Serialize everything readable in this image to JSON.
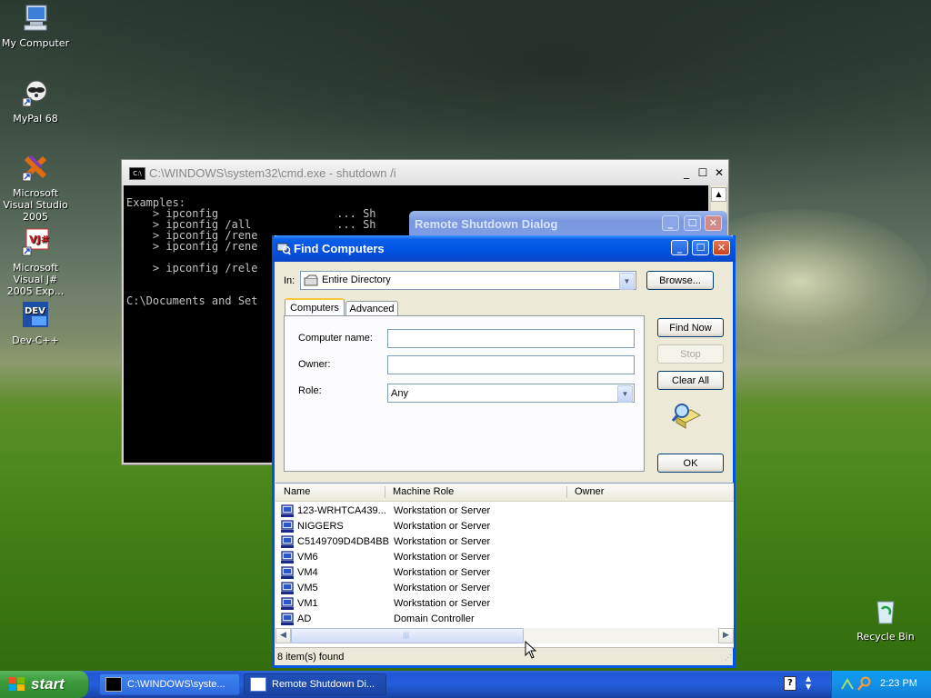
{
  "desktop": {
    "icons": [
      {
        "label": "My Computer"
      },
      {
        "label": "MyPal 68"
      },
      {
        "label": "Microsoft Visual Studio 2005"
      },
      {
        "label": "Microsoft Visual J# 2005 Exp..."
      },
      {
        "label": "Dev-C++"
      },
      {
        "label": "Recycle Bin"
      }
    ]
  },
  "cmd_window": {
    "title": "C:\\WINDOWS\\system32\\cmd.exe - shutdown /i",
    "lines": [
      "Examples:",
      "    > ipconfig                  ... Sh",
      "    > ipconfig /all             ... Sh",
      "    > ipconfig /rene",
      "    > ipconfig /rene",
      "",
      "    > ipconfig /rele",
      "",
      "",
      "C:\\Documents and Set"
    ]
  },
  "remote_shutdown": {
    "title": "Remote Shutdown Dialog"
  },
  "find_computers": {
    "title": "Find Computers",
    "in_label": "In:",
    "in_value": "Entire Directory",
    "browse_label": "Browse...",
    "tabs": [
      {
        "label": "Computers"
      },
      {
        "label": "Advanced"
      }
    ],
    "computer_name_label": "Computer name:",
    "owner_label": "Owner:",
    "role_label": "Role:",
    "role_value": "Any",
    "find_now_label": "Find Now",
    "stop_label": "Stop",
    "clear_all_label": "Clear All",
    "ok_label": "OK",
    "columns": {
      "name": "Name",
      "role": "Machine Role",
      "owner": "Owner"
    },
    "rows": [
      {
        "name": "123-WRHTCA439...",
        "role": "Workstation or Server"
      },
      {
        "name": "NIGGERS",
        "role": "Workstation or Server"
      },
      {
        "name": "C5149709D4DB4BB",
        "role": "Workstation or Server"
      },
      {
        "name": "VM6",
        "role": "Workstation or Server"
      },
      {
        "name": "VM4",
        "role": "Workstation or Server"
      },
      {
        "name": "VM5",
        "role": "Workstation or Server"
      },
      {
        "name": "VM1",
        "role": "Workstation or Server"
      },
      {
        "name": "AD",
        "role": "Domain Controller"
      }
    ],
    "status": "8 item(s) found"
  },
  "taskbar": {
    "start_label": "start",
    "tasks": [
      {
        "label": "C:\\WINDOWS\\syste..."
      },
      {
        "label": "Remote Shutdown Di..."
      }
    ],
    "clock": "2:23 PM"
  }
}
